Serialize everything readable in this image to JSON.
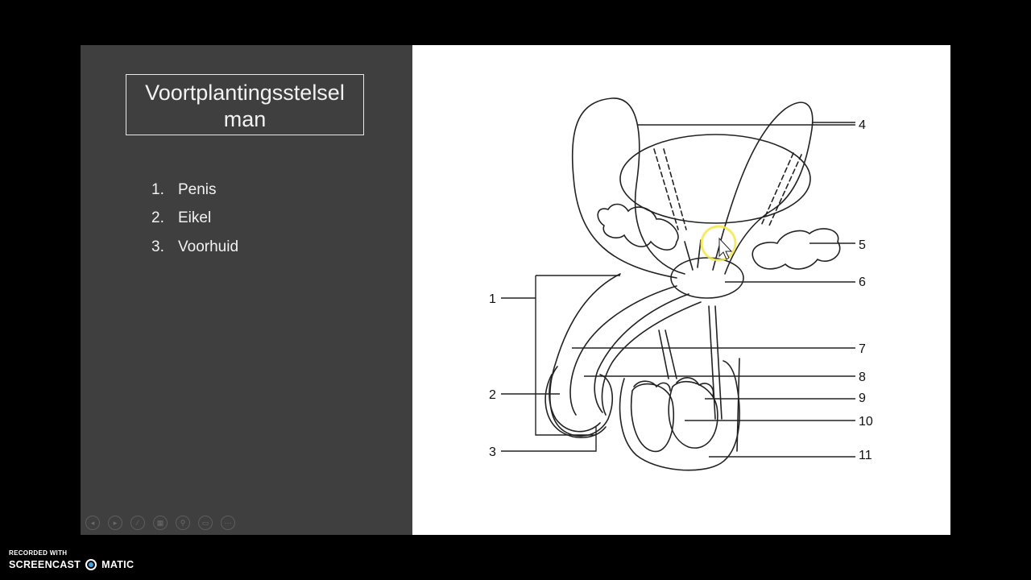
{
  "slide": {
    "title_line1": "Voortplantingsstelsel",
    "title_line2": "man",
    "bullets": [
      {
        "num": "1.",
        "text": "Penis"
      },
      {
        "num": "2.",
        "text": "Eikel"
      },
      {
        "num": "3.",
        "text": "Voorhuid"
      }
    ]
  },
  "diagram": {
    "labels": [
      "1",
      "2",
      "3",
      "4",
      "5",
      "6",
      "7",
      "8",
      "9",
      "10",
      "11"
    ]
  },
  "controls": [
    {
      "name": "previous-slide-icon",
      "glyph": "◂"
    },
    {
      "name": "next-slide-icon",
      "glyph": "▸"
    },
    {
      "name": "pen-icon",
      "glyph": "⁄"
    },
    {
      "name": "see-all-slides-icon",
      "glyph": "▦"
    },
    {
      "name": "zoom-icon",
      "glyph": "⚲"
    },
    {
      "name": "subtitles-icon",
      "glyph": "▭"
    },
    {
      "name": "more-options-icon",
      "glyph": "⋯"
    }
  ],
  "watermark": {
    "line1": "RECORDED WITH",
    "brand_left": "SCREENCAST",
    "brand_right": "MATIC"
  }
}
